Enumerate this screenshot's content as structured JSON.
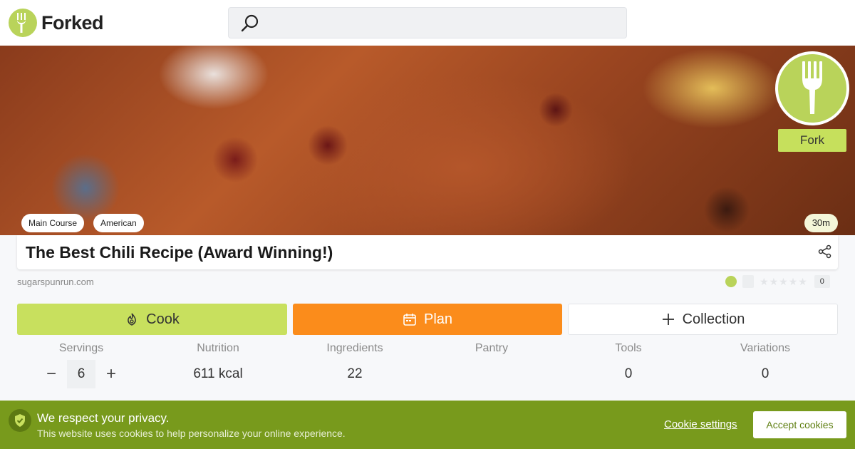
{
  "app": {
    "name": "Forked"
  },
  "search": {
    "placeholder": ""
  },
  "hero": {
    "tags": [
      "Main Course",
      "American"
    ],
    "time": "30m",
    "fork_label": "Fork"
  },
  "recipe": {
    "title": "The Best Chili Recipe (Award Winning!)",
    "source": "sugarspunrun.com",
    "rating_count": "0",
    "stars": 0
  },
  "actions": {
    "cook": "Cook",
    "plan": "Plan",
    "collection": "Collection"
  },
  "stats": {
    "servings_label": "Servings",
    "servings_value": "6",
    "minus": "−",
    "plus": "+",
    "nutrition_label": "Nutrition",
    "nutrition_value": "611 kcal",
    "ingredients_label": "Ingredients",
    "ingredients_value": "22",
    "pantry_label": "Pantry",
    "pantry_value": "",
    "tools_label": "Tools",
    "tools_value": "0",
    "variations_label": "Variations",
    "variations_value": "0"
  },
  "cookie": {
    "title": "We respect your privacy.",
    "text": "This website uses cookies to help personalize your online experience.",
    "settings": "Cookie settings",
    "accept": "Accept cookies"
  },
  "colors": {
    "brand_green": "#b9d35a",
    "plan_orange": "#fb8c1b",
    "cookie_banner": "#789a1c"
  },
  "icons": [
    "fork-icon",
    "search-icon",
    "share-icon",
    "flame-icon",
    "calendar-icon",
    "plus-icon",
    "shield-check-icon"
  ]
}
